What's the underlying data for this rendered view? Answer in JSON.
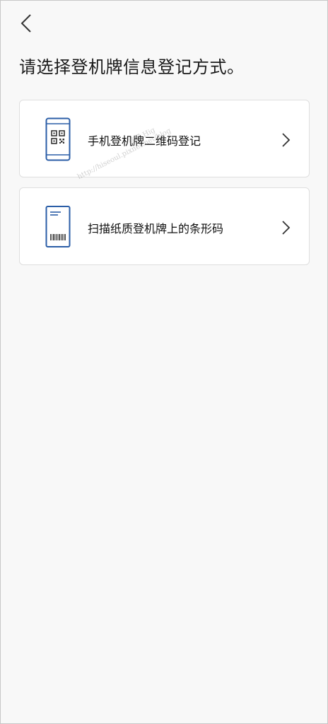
{
  "header": {
    "back_icon": "chevron-left-icon",
    "title": "请选择登机牌信息登记方式。"
  },
  "options": [
    {
      "label": "手机登机牌二维码登记",
      "icon": "phone-qr-code-icon",
      "arrow_icon": "chevron-right-icon"
    },
    {
      "label": "扫描纸质登机牌上的条形码",
      "icon": "paper-boarding-pass-barcode-icon",
      "arrow_icon": "chevron-right-icon"
    }
  ],
  "watermark": {
    "line1": "http://hiseoul.pixnet.net/blog",
    "line2": "首爾 Hig"
  },
  "colors": {
    "icon_blue": "#2b5ea7",
    "text": "#111111",
    "card_border": "#dedede",
    "background": "#f8f8f8"
  }
}
